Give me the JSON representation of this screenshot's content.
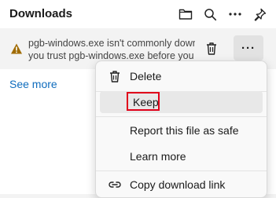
{
  "header": {
    "title": "Downloads",
    "icons": [
      "folder-icon",
      "search-icon",
      "more-icon",
      "pin-icon"
    ]
  },
  "download_item": {
    "message_line1": "pgb-windows.exe isn't commonly down",
    "message_line2": "you trust pgb-windows.exe before you",
    "delete_icon": "trash-icon",
    "more_label": "···"
  },
  "see_more_label": "See more",
  "context_menu": {
    "items": [
      {
        "label": "Delete",
        "icon": "trash-icon"
      },
      {
        "label": "Keep",
        "icon": ""
      },
      {
        "label": "Report this file as safe",
        "icon": ""
      },
      {
        "label": "Learn more",
        "icon": ""
      },
      {
        "label": "Copy download link",
        "icon": "link-icon"
      }
    ]
  },
  "colors": {
    "link": "#0f6cbd",
    "warning": "#a06b00",
    "highlight_box": "#e0001a"
  }
}
